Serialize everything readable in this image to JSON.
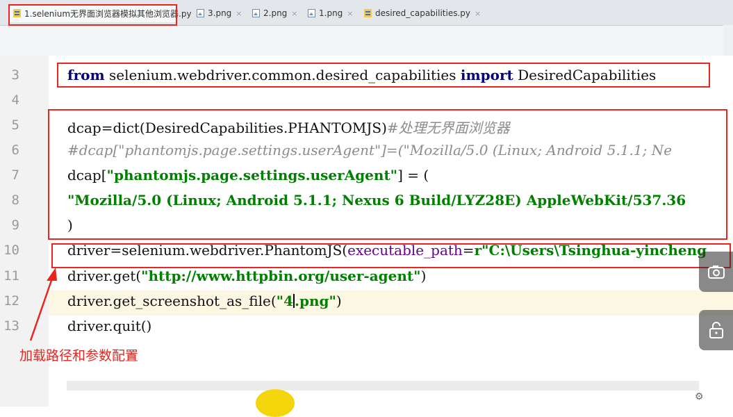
{
  "tabs": [
    {
      "label": "1.selenium无界面浏览器模拟其他浏览器.py",
      "icon": "python-file-icon",
      "active": true
    },
    {
      "label": "3.png",
      "icon": "image-file-icon"
    },
    {
      "label": "2.png",
      "icon": "image-file-icon"
    },
    {
      "label": "1.png",
      "icon": "image-file-icon"
    },
    {
      "label": "desired_capabilities.py",
      "icon": "python-file-icon"
    }
  ],
  "tab_close": "×",
  "line_numbers": [
    "3",
    "4",
    "5",
    "6",
    "7",
    "8",
    "9",
    "10",
    "11",
    "12",
    "13"
  ],
  "code": {
    "l3": {
      "kw1": "from",
      "mod": " selenium.webdriver.common.desired_capabilities ",
      "kw2": "import",
      "name": " DesiredCapabilities"
    },
    "l5": {
      "code": "dcap=dict(DesiredCapabilities.PHANTOMJS)",
      "comment": "#处理无界面浏览器"
    },
    "l6": {
      "comment": "#dcap[\"phantomjs.page.settings.userAgent\"]=(\"Mozilla/5.0 (Linux; Android 5.1.1; Ne"
    },
    "l7": {
      "a": "dcap[",
      "s": "\"phantomjs.page.settings.userAgent\"",
      "b": "] = ("
    },
    "l8": {
      "s": "\"Mozilla/5.0 (Linux; Android 5.1.1; Nexus 6 Build/LYZ28E) AppleWebKit/537.36"
    },
    "l9": {
      "code": ")"
    },
    "l10": {
      "a": "driver=selenium.webdriver.PhantomJS(",
      "p": "executable_path",
      "eq": "=",
      "s": "r\"C:\\Users\\Tsinghua-yincheng"
    },
    "l11": {
      "a": "driver.get(",
      "s": "\"http://www.httpbin.org/user-agent\"",
      "b": ")"
    },
    "l12": {
      "a": "driver.get_screenshot_as_file(",
      "s1": "\"4",
      "s2": ".png\"",
      "b": ")"
    },
    "l13": {
      "code": "driver.quit()"
    }
  },
  "annotation": "加载路径和参数配置",
  "colors": {
    "annotation_red": "#e8261f",
    "keyword": "#000080",
    "string": "#008000",
    "comment": "#8c8c8c",
    "param": "#660099",
    "current_line": "#fbf7e2"
  }
}
